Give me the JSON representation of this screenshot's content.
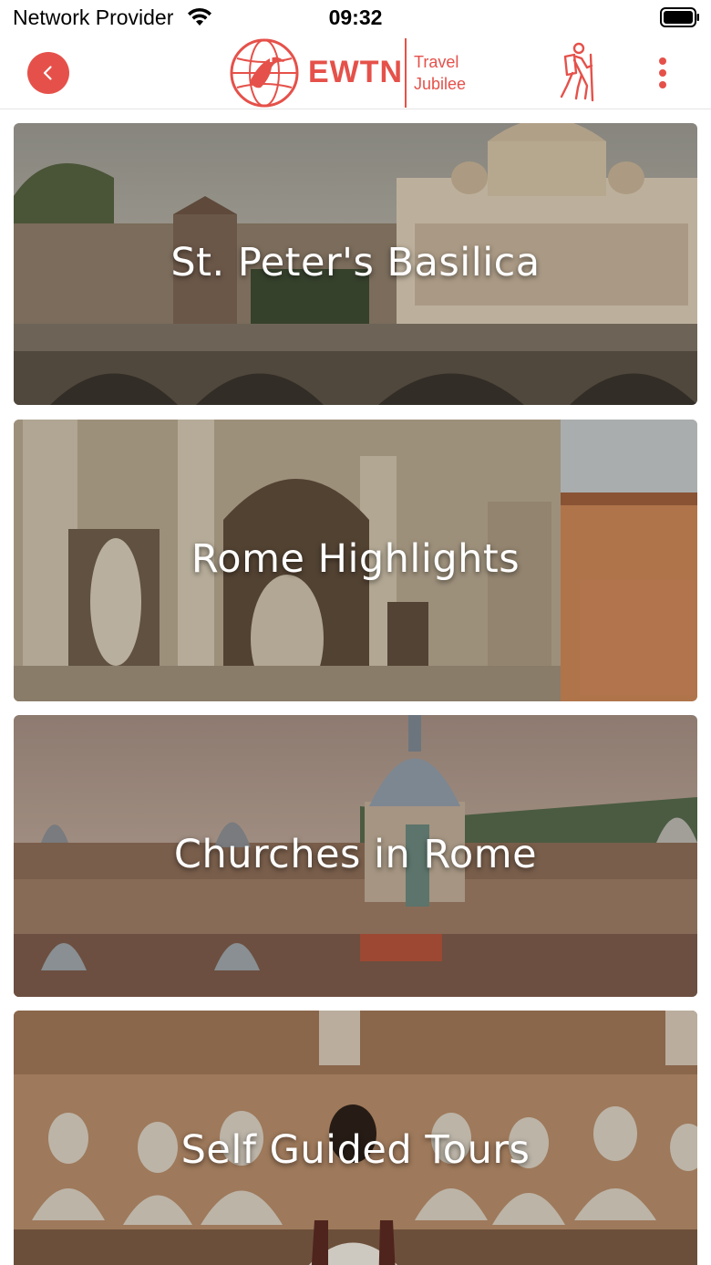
{
  "status_bar": {
    "carrier": "Network Provider",
    "time": "09:32"
  },
  "header": {
    "back_icon": "chevron-left-icon",
    "logo": {
      "brand": "EWTN",
      "line1": "Travel",
      "line2": "Jubilee"
    },
    "tours_icon": "hiker-icon",
    "menu_icon": "more-vertical-icon",
    "accent_color": "#e5514a"
  },
  "cards": [
    {
      "title": "St. Peter's Basilica"
    },
    {
      "title": "Rome Highlights"
    },
    {
      "title": "Churches in Rome"
    },
    {
      "title": "Self Guided Tours"
    }
  ]
}
